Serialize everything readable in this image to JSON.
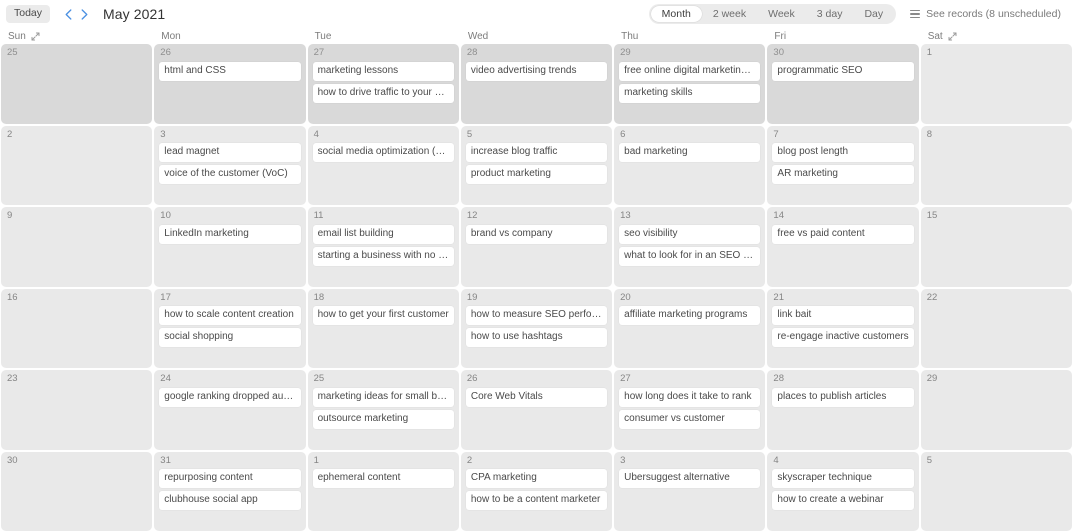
{
  "toolbar": {
    "today_label": "Today",
    "prev_icon": "chevron-left-icon",
    "next_icon": "chevron-right-icon",
    "title": "May 2021",
    "views": [
      {
        "label": "Month",
        "active": true
      },
      {
        "label": "2 week",
        "active": false
      },
      {
        "label": "Week",
        "active": false
      },
      {
        "label": "3 day",
        "active": false
      },
      {
        "label": "Day",
        "active": false
      }
    ],
    "records_label": "See records (8 unscheduled)",
    "records_icon": "list-icon"
  },
  "weekdays": [
    {
      "label": "Sun",
      "expand": true
    },
    {
      "label": "Mon",
      "expand": false
    },
    {
      "label": "Tue",
      "expand": false
    },
    {
      "label": "Wed",
      "expand": false
    },
    {
      "label": "Thu",
      "expand": false
    },
    {
      "label": "Fri",
      "expand": false
    },
    {
      "label": "Sat",
      "expand": true
    }
  ],
  "cells": [
    {
      "day": "25",
      "other_month": true,
      "events": []
    },
    {
      "day": "26",
      "other_month": true,
      "events": [
        "html and CSS"
      ]
    },
    {
      "day": "27",
      "other_month": true,
      "events": [
        "marketing lessons",
        "how to drive traffic to your shopify ..."
      ]
    },
    {
      "day": "28",
      "other_month": true,
      "events": [
        "video advertising trends"
      ]
    },
    {
      "day": "29",
      "other_month": true,
      "events": [
        "free online digital marketing courses",
        "marketing skills"
      ]
    },
    {
      "day": "30",
      "other_month": true,
      "events": [
        "programmatic SEO"
      ]
    },
    {
      "day": "1",
      "other_month": false,
      "events": []
    },
    {
      "day": "2",
      "other_month": false,
      "events": []
    },
    {
      "day": "3",
      "other_month": false,
      "events": [
        "lead magnet",
        "voice of the customer (VoC)"
      ]
    },
    {
      "day": "4",
      "other_month": false,
      "events": [
        "social media optimization (SMO)"
      ]
    },
    {
      "day": "5",
      "other_month": false,
      "events": [
        "increase blog traffic",
        "product marketing"
      ]
    },
    {
      "day": "6",
      "other_month": false,
      "events": [
        "bad marketing"
      ]
    },
    {
      "day": "7",
      "other_month": false,
      "events": [
        "blog post length",
        "AR marketing"
      ]
    },
    {
      "day": "8",
      "other_month": false,
      "events": []
    },
    {
      "day": "9",
      "other_month": false,
      "events": []
    },
    {
      "day": "10",
      "other_month": false,
      "events": [
        "LinkedIn marketing"
      ]
    },
    {
      "day": "11",
      "other_month": false,
      "events": [
        "email list building",
        "starting a business with no experien..."
      ]
    },
    {
      "day": "12",
      "other_month": false,
      "events": [
        "brand vs company"
      ]
    },
    {
      "day": "13",
      "other_month": false,
      "events": [
        "seo visibility",
        "what to look for in an SEO Company"
      ]
    },
    {
      "day": "14",
      "other_month": false,
      "events": [
        "free vs paid content"
      ]
    },
    {
      "day": "15",
      "other_month": false,
      "events": []
    },
    {
      "day": "16",
      "other_month": false,
      "events": []
    },
    {
      "day": "17",
      "other_month": false,
      "events": [
        "how to scale content creation",
        "social shopping"
      ]
    },
    {
      "day": "18",
      "other_month": false,
      "events": [
        "how to get your first customer"
      ]
    },
    {
      "day": "19",
      "other_month": false,
      "events": [
        "how to measure SEO performance",
        "how to use hashtags"
      ]
    },
    {
      "day": "20",
      "other_month": false,
      "events": [
        "affiliate marketing programs"
      ]
    },
    {
      "day": "21",
      "other_month": false,
      "events": [
        "link bait",
        "re-engage inactive customers"
      ]
    },
    {
      "day": "22",
      "other_month": false,
      "events": []
    },
    {
      "day": "23",
      "other_month": false,
      "events": []
    },
    {
      "day": "24",
      "other_month": false,
      "events": [
        "google ranking dropped automatic..."
      ]
    },
    {
      "day": "25",
      "other_month": false,
      "events": [
        "marketing ideas for small business",
        "outsource marketing"
      ]
    },
    {
      "day": "26",
      "other_month": false,
      "events": [
        "Core Web Vitals"
      ]
    },
    {
      "day": "27",
      "other_month": false,
      "events": [
        "how long does it take to rank",
        "consumer vs customer"
      ]
    },
    {
      "day": "28",
      "other_month": false,
      "events": [
        "places to publish articles"
      ]
    },
    {
      "day": "29",
      "other_month": false,
      "events": []
    },
    {
      "day": "30",
      "other_month": false,
      "events": []
    },
    {
      "day": "31",
      "other_month": false,
      "events": [
        "repurposing content",
        "clubhouse social app"
      ]
    },
    {
      "day": "1",
      "other_month": false,
      "events": [
        "ephemeral content"
      ]
    },
    {
      "day": "2",
      "other_month": false,
      "events": [
        "CPA marketing",
        "how to be a content marketer"
      ]
    },
    {
      "day": "3",
      "other_month": false,
      "events": [
        "Ubersuggest alternative"
      ]
    },
    {
      "day": "4",
      "other_month": false,
      "events": [
        "skyscraper technique",
        "how to create a webinar"
      ]
    },
    {
      "day": "5",
      "other_month": false,
      "events": []
    }
  ]
}
